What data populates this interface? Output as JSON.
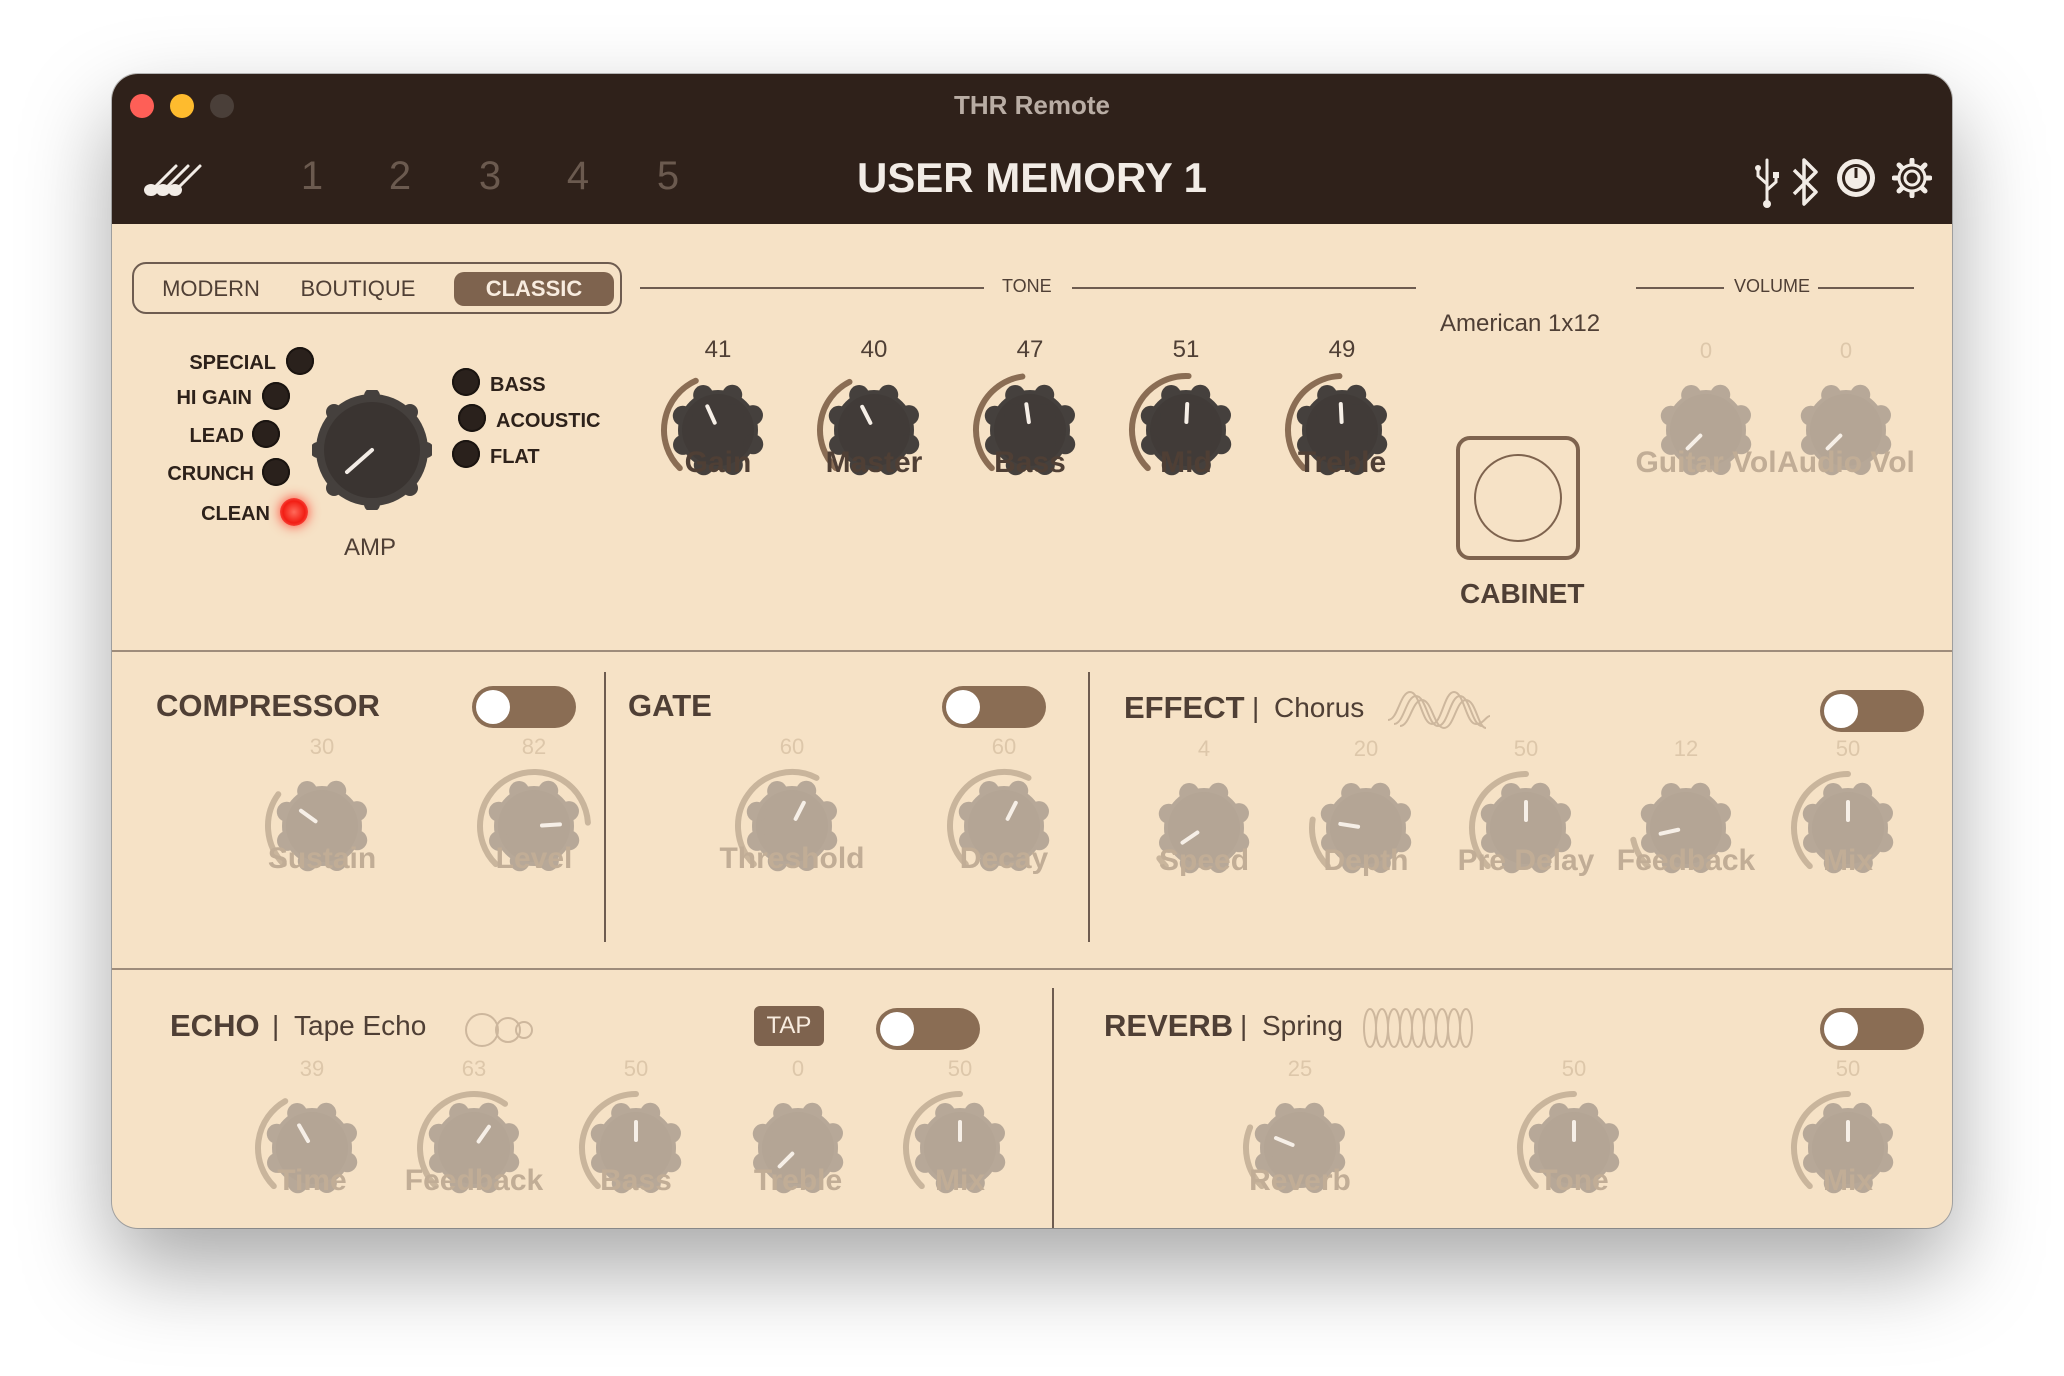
{
  "window": {
    "title": "THR Remote"
  },
  "header": {
    "presets": [
      "1",
      "2",
      "3",
      "4",
      "5"
    ],
    "memory_name": "USER MEMORY 1"
  },
  "amp": {
    "collections": [
      {
        "label": "MODERN",
        "active": false
      },
      {
        "label": "BOUTIQUE",
        "active": false
      },
      {
        "label": "CLASSIC",
        "active": true
      }
    ],
    "types_left": [
      "SPECIAL",
      "HI GAIN",
      "LEAD",
      "CRUNCH",
      "CLEAN"
    ],
    "active_type": "CLEAN",
    "types_right": [
      "BASS",
      "ACOUSTIC",
      "FLAT"
    ],
    "selector_label": "AMP"
  },
  "tone": {
    "section_label": "TONE",
    "knobs": [
      {
        "label": "Gain",
        "value": "41"
      },
      {
        "label": "Master",
        "value": "40"
      },
      {
        "label": "Bass",
        "value": "47"
      },
      {
        "label": "Mid",
        "value": "51"
      },
      {
        "label": "Treble",
        "value": "49"
      }
    ]
  },
  "cabinet": {
    "name": "American 1x12",
    "label": "CABINET"
  },
  "volume": {
    "section_label": "VOLUME",
    "knobs": [
      {
        "label": "Guitar Vol",
        "value": "0"
      },
      {
        "label": "Audio Vol",
        "value": "0"
      }
    ]
  },
  "compressor": {
    "title": "COMPRESSOR",
    "enabled": false,
    "knobs": [
      {
        "label": "Sustain",
        "value": "30"
      },
      {
        "label": "Level",
        "value": "82"
      }
    ]
  },
  "gate": {
    "title": "GATE",
    "enabled": false,
    "knobs": [
      {
        "label": "Threshold",
        "value": "60"
      },
      {
        "label": "Decay",
        "value": "60"
      }
    ]
  },
  "effect": {
    "title": "EFFECT",
    "type": "Chorus",
    "enabled": false,
    "knobs": [
      {
        "label": "Speed",
        "value": "4"
      },
      {
        "label": "Depth",
        "value": "20"
      },
      {
        "label": "Pre Delay",
        "value": "50"
      },
      {
        "label": "Feedback",
        "value": "12"
      },
      {
        "label": "Mix",
        "value": "50"
      }
    ]
  },
  "echo": {
    "title": "ECHO",
    "type": "Tape Echo",
    "tap_label": "TAP",
    "enabled": false,
    "knobs": [
      {
        "label": "Time",
        "value": "39"
      },
      {
        "label": "Feedback",
        "value": "63"
      },
      {
        "label": "Bass",
        "value": "50"
      },
      {
        "label": "Treble",
        "value": "0"
      },
      {
        "label": "Mix",
        "value": "50"
      }
    ]
  },
  "reverb": {
    "title": "REVERB",
    "type": "Spring",
    "enabled": false,
    "knobs": [
      {
        "label": "Reverb",
        "value": "25"
      },
      {
        "label": "Tone",
        "value": "50"
      },
      {
        "label": "Mix",
        "value": "50"
      }
    ]
  },
  "colors": {
    "titlebar": "#2f211a",
    "panel": "#f6e2c6",
    "accent": "#7e634e",
    "knob_active": "#45403d",
    "knob_inactive": "#b7a898",
    "led_on": "#f21e14"
  }
}
